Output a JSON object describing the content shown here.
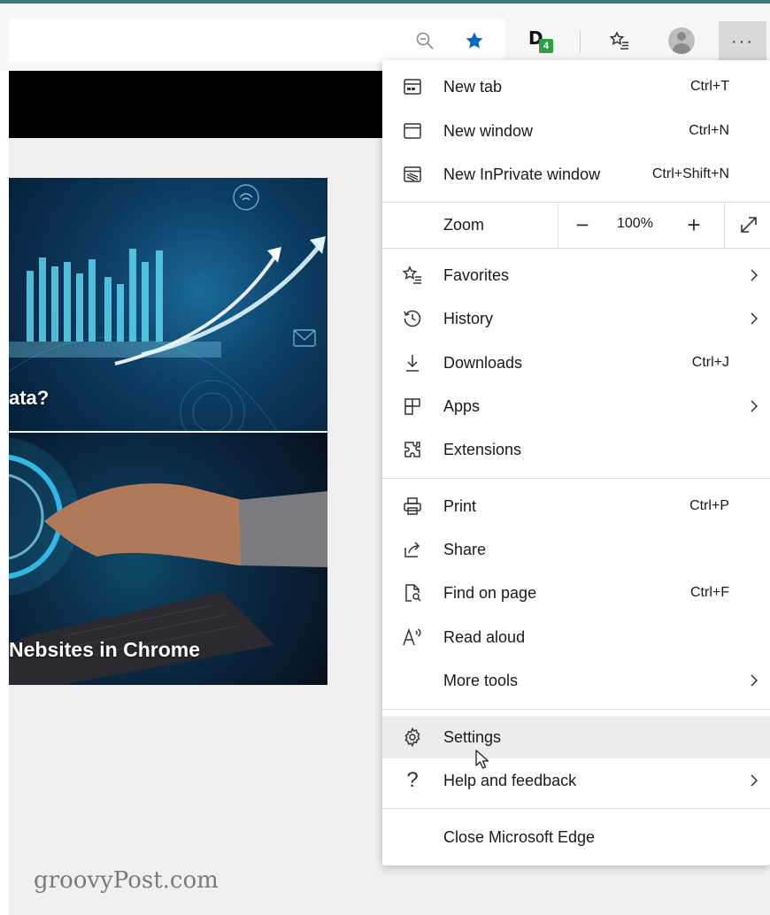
{
  "card_captions": [
    "ata?",
    "Nebsites in Chrome"
  ],
  "watermark": "groovyPost.com",
  "extension_badge": {
    "letter": "D",
    "count": "4"
  },
  "toolbar": {
    "more_label": "···"
  },
  "menu": {
    "group1": [
      {
        "label": "New tab",
        "shortcut": "Ctrl+T",
        "icon": "new-tab-icon"
      },
      {
        "label": "New window",
        "shortcut": "Ctrl+N",
        "icon": "new-window-icon"
      },
      {
        "label": "New InPrivate window",
        "shortcut": "Ctrl+Shift+N",
        "icon": "inprivate-icon"
      }
    ],
    "zoom": {
      "label": "Zoom",
      "minus": "−",
      "value": "100%",
      "plus": "+"
    },
    "group2": [
      {
        "label": "Favorites",
        "icon": "favorites-icon"
      },
      {
        "label": "History",
        "icon": "history-icon"
      },
      {
        "label": "Downloads",
        "shortcut": "Ctrl+J",
        "icon": "download-icon"
      },
      {
        "label": "Apps",
        "icon": "apps-icon"
      },
      {
        "label": "Extensions",
        "icon": "extensions-icon"
      }
    ],
    "group3": [
      {
        "label": "Print",
        "shortcut": "Ctrl+P",
        "icon": "print-icon"
      },
      {
        "label": "Share",
        "icon": "share-icon"
      },
      {
        "label": "Find on page",
        "shortcut": "Ctrl+F",
        "icon": "find-on-page-icon"
      },
      {
        "label": "Read aloud",
        "icon": "read-aloud-icon"
      },
      {
        "label": "More tools"
      }
    ],
    "group4": [
      {
        "label": "Settings",
        "icon": "gear-icon"
      },
      {
        "label": "Help and feedback",
        "icon": "help-icon"
      }
    ],
    "group5": [
      {
        "label": "Close Microsoft Edge"
      }
    ]
  },
  "colors": {
    "accent_star": "#0067c0",
    "badge_green": "#2e9e3e",
    "chart_cyan": "#5fd3f0"
  }
}
